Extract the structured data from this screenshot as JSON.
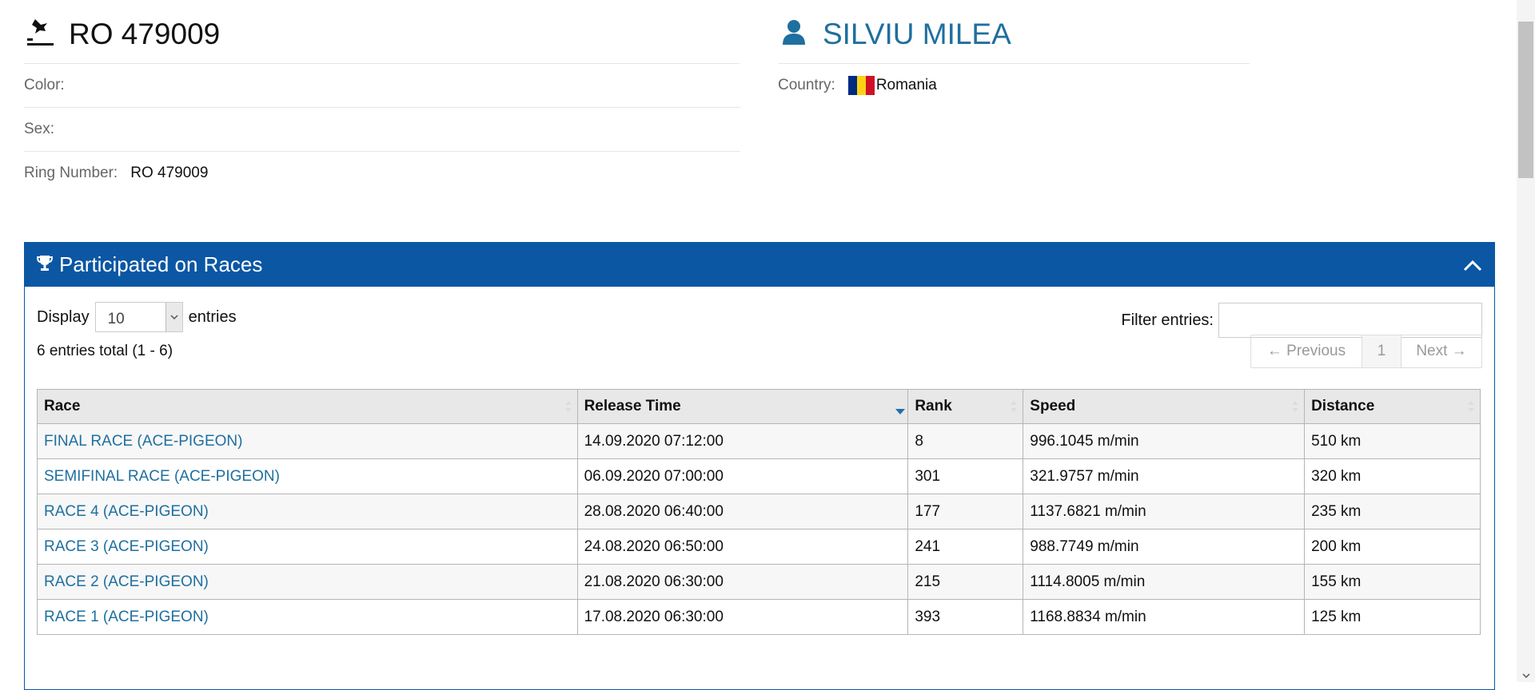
{
  "pigeon": {
    "title": "RO 479009",
    "icon": "bird-landing-icon",
    "color_label": "Color:",
    "color_value": "",
    "sex_label": "Sex:",
    "sex_value": "",
    "ring_label": "Ring Number:",
    "ring_value": "RO 479009"
  },
  "owner": {
    "name": "SILVIU MILEA",
    "icon": "user-icon",
    "country_label": "Country:",
    "country_value": "Romania",
    "flag_colors": [
      "#002b7f",
      "#fcd116",
      "#ce1126"
    ]
  },
  "panel": {
    "title": "Participated on Races",
    "icon": "trophy-icon",
    "header_color": "#0b57a4",
    "display_label": "Display",
    "display_value": "10",
    "entries_label": "entries",
    "filter_label": "Filter entries:",
    "filter_value": "",
    "info": "6 entries total (1 - 6)",
    "pager": {
      "prev": "← Previous",
      "page": "1",
      "next": "Next →"
    }
  },
  "table": {
    "columns": [
      "Race",
      "Release Time",
      "Rank",
      "Speed",
      "Distance"
    ],
    "sorted_column": "Release Time",
    "rows": [
      {
        "race": "FINAL RACE (ACE-PIGEON)",
        "release": "14.09.2020 07:12:00",
        "rank": "8",
        "speed": "996.1045 m/min",
        "distance": "510 km"
      },
      {
        "race": "SEMIFINAL RACE (ACE-PIGEON)",
        "release": "06.09.2020 07:00:00",
        "rank": "301",
        "speed": "321.9757 m/min",
        "distance": "320 km"
      },
      {
        "race": "RACE 4 (ACE-PIGEON)",
        "release": "28.08.2020 06:40:00",
        "rank": "177",
        "speed": "1137.6821 m/min",
        "distance": "235 km"
      },
      {
        "race": "RACE 3 (ACE-PIGEON)",
        "release": "24.08.2020 06:50:00",
        "rank": "241",
        "speed": "988.7749 m/min",
        "distance": "200 km"
      },
      {
        "race": "RACE 2 (ACE-PIGEON)",
        "release": "21.08.2020 06:30:00",
        "rank": "215",
        "speed": "1114.8005 m/min",
        "distance": "155 km"
      },
      {
        "race": "RACE 1 (ACE-PIGEON)",
        "release": "17.08.2020 06:30:00",
        "rank": "393",
        "speed": "1168.8834 m/min",
        "distance": "125 km"
      }
    ]
  }
}
